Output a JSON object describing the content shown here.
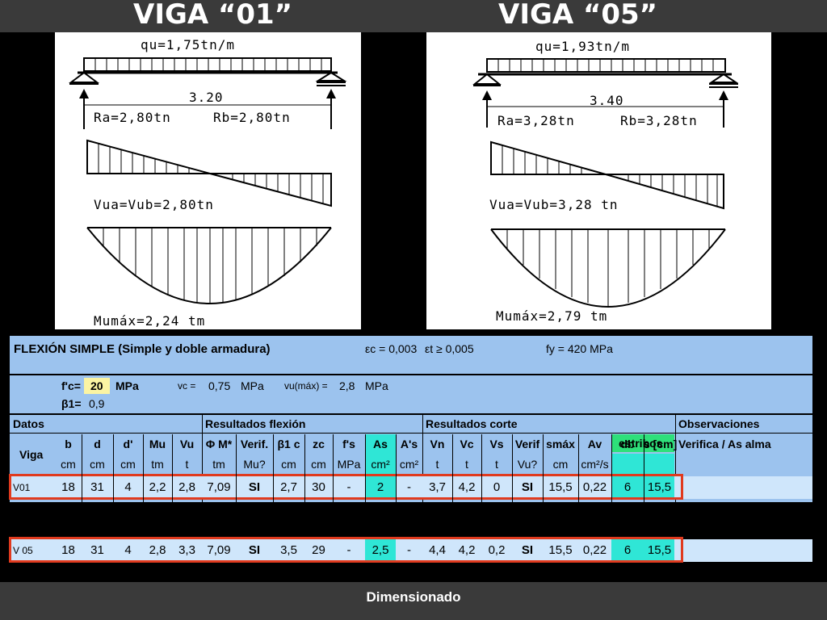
{
  "header": {
    "title_left": "VIGA “01”",
    "title_right": "VIGA “05”"
  },
  "footer": {
    "label": "Dimensionado"
  },
  "beam1": {
    "load": "qu=1,75tn/m",
    "span": "3.20",
    "ra": "Ra=2,80tn",
    "rb": "Rb=2,80tn",
    "shear": "Vua=Vub=2,80tn",
    "moment": "Mumáx=2,24  tm"
  },
  "beam2": {
    "load": "qu=1,93tn/m",
    "span": "3.40",
    "ra": "Ra=3,28tn",
    "rb": "Rb=3,28tn",
    "shear": "Vua=Vub=3,28  tn",
    "moment": "Mumáx=2,79  tm"
  },
  "sheet": {
    "title": "FLEXIÓN SIMPLE (Simple y doble armadura)",
    "eps_c": "εc = 0,003",
    "eps_t": "εt ≥ 0,005",
    "fy": "fy = 420 MPa",
    "fc_label": "f'c=",
    "fc_value": "20",
    "fc_unit": "MPa",
    "vc_label": "vc =",
    "vc_value": "0,75",
    "vc_unit": "MPa",
    "vumax_label": "vu(máx) =",
    "vumax_value": "2,8",
    "vumax_unit": "MPa",
    "beta_label": "β1=",
    "beta_value": "0,9",
    "sections": {
      "datos": "Datos",
      "flexion": "Resultados flexión",
      "corte": "Resultados corte",
      "obs": "Observaciones"
    },
    "obs_sub": "Verifica / As alma",
    "col_viga": "Viga",
    "estribos": "estribos",
    "headers": [
      "b",
      "d",
      "d'",
      "Mu",
      "Vu",
      "Φ M*",
      "Verif.",
      "β1 c",
      "zc",
      "f's",
      "As",
      "A's",
      "Vn",
      "Vc",
      "Vs",
      "Verif",
      "smáx",
      "Av",
      "db",
      "s [cm]"
    ],
    "units": [
      "cm",
      "cm",
      "cm",
      "tm",
      "t",
      "tm",
      "Mu?",
      "cm",
      "cm",
      "MPa",
      "cm²",
      "cm²",
      "t",
      "t",
      "t",
      "Vu?",
      "cm",
      "cm²/s"
    ],
    "rows": [
      {
        "viga": "V01",
        "values": [
          "18",
          "31",
          "4",
          "2,2",
          "2,8",
          "7,09",
          "SI",
          "2,7",
          "30",
          "-",
          "2",
          "-",
          "3,7",
          "4,2",
          "0",
          "SI",
          "15,5",
          "0,22",
          "6",
          "15,5"
        ]
      },
      {
        "viga": "V 05",
        "values": [
          "18",
          "31",
          "4",
          "2,8",
          "3,3",
          "7,09",
          "SI",
          "3,5",
          "29",
          "-",
          "2,5",
          "-",
          "4,4",
          "4,2",
          "0,2",
          "SI",
          "15,5",
          "0,22",
          "6",
          "15,5"
        ]
      }
    ]
  },
  "colors": {
    "bar": "#3a3a3a",
    "sheet": "#9cc3ee",
    "row": "#cfe6fb",
    "highlight": "#e03a1e",
    "cyan": "#2fe6d6",
    "green": "#2ee07a",
    "yellow": "#fbf4a3"
  }
}
